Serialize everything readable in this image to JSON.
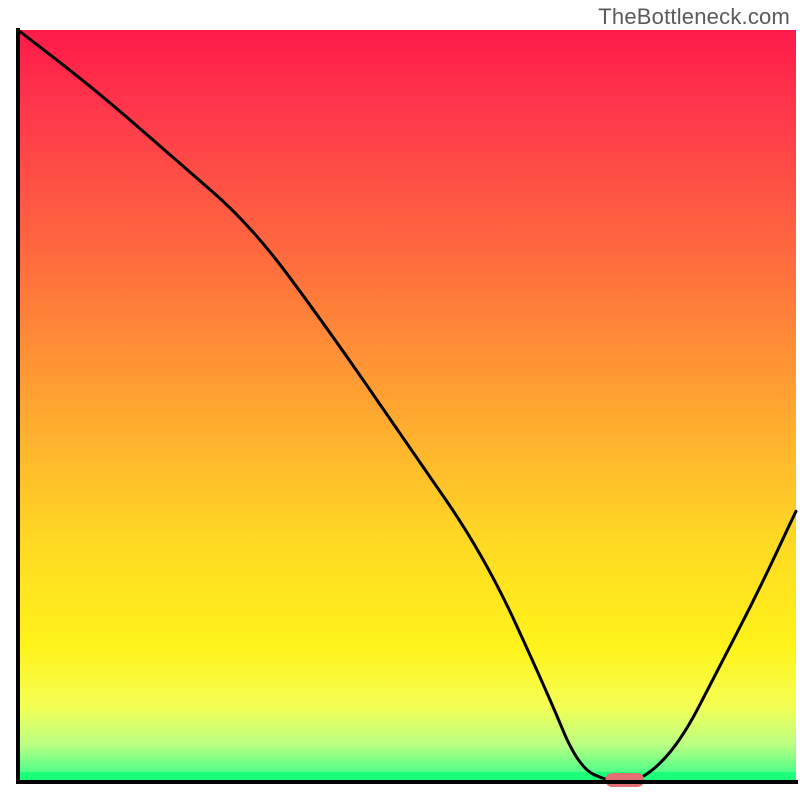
{
  "watermark": "TheBottleneck.com",
  "chart_data": {
    "type": "line",
    "title": "",
    "xlabel": "",
    "ylabel": "",
    "xlim": [
      0,
      100
    ],
    "ylim": [
      0,
      100
    ],
    "series": [
      {
        "name": "bottleneck-curve",
        "x": [
          0,
          10,
          20,
          30,
          40,
          50,
          60,
          68,
          72,
          76,
          80,
          85,
          90,
          95,
          100
        ],
        "y": [
          100,
          92,
          83,
          74,
          60,
          45,
          30,
          12,
          2,
          0,
          0,
          5,
          15,
          25,
          36
        ]
      }
    ],
    "marker": {
      "name": "optimal-point",
      "x_center": 78,
      "width": 5,
      "color": "#e36f72"
    },
    "gradient_stops": [
      {
        "offset": 0.0,
        "color": "#ff1a4a"
      },
      {
        "offset": 0.12,
        "color": "#ff3b4a"
      },
      {
        "offset": 0.3,
        "color": "#ff6a3e"
      },
      {
        "offset": 0.5,
        "color": "#ffa531"
      },
      {
        "offset": 0.68,
        "color": "#ffd923"
      },
      {
        "offset": 0.82,
        "color": "#fff31a"
      },
      {
        "offset": 0.9,
        "color": "#f4ff55"
      },
      {
        "offset": 0.95,
        "color": "#baff82"
      },
      {
        "offset": 1.0,
        "color": "#2cff8a"
      }
    ],
    "axis_color": "#000000",
    "line_color": "#000000",
    "line_width": 3
  }
}
